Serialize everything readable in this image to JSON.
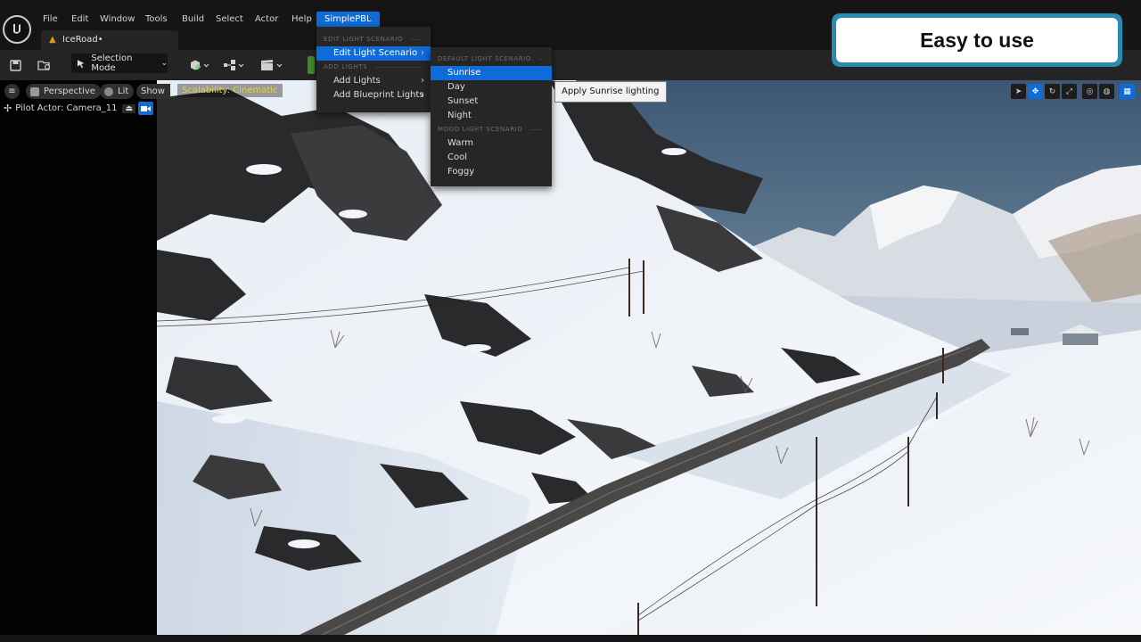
{
  "app": {
    "document_tab": "IceRoad•"
  },
  "menu": {
    "items": [
      "File",
      "Edit",
      "Window",
      "Tools",
      "Build",
      "Select",
      "Actor",
      "Help"
    ],
    "active": "SimplePBL"
  },
  "toolbar": {
    "selection_mode": "Selection Mode"
  },
  "viewport": {
    "perspective": "Perspective",
    "lit": "Lit",
    "show": "Show",
    "scalability": "Scalability: Cinematic",
    "pilot": "Pilot Actor: Camera_11"
  },
  "simplepbl_menu": {
    "section_edit": "EDIT LIGHT SCENARIO",
    "edit_light_scenario": "Edit Light Scenario",
    "section_add": "ADD LIGHTS",
    "add_lights": "Add Lights",
    "add_blueprint_lights": "Add Blueprint Lights"
  },
  "scenario_menu": {
    "section_default": "DEFAULT LIGHT SCENARIO",
    "default_items": [
      "Sunrise",
      "Day",
      "Sunset",
      "Night"
    ],
    "section_mood": "MOOD LIGHT SCENARIO",
    "mood_items": [
      "Warm",
      "Cool",
      "Foggy"
    ],
    "highlighted": "Sunrise"
  },
  "tooltip": "Apply Sunrise lighting",
  "callout": "Easy to use",
  "colors": {
    "accent": "#0f6bd8",
    "callout_border": "#1a8fb5",
    "scalability": "#e8d33a"
  }
}
